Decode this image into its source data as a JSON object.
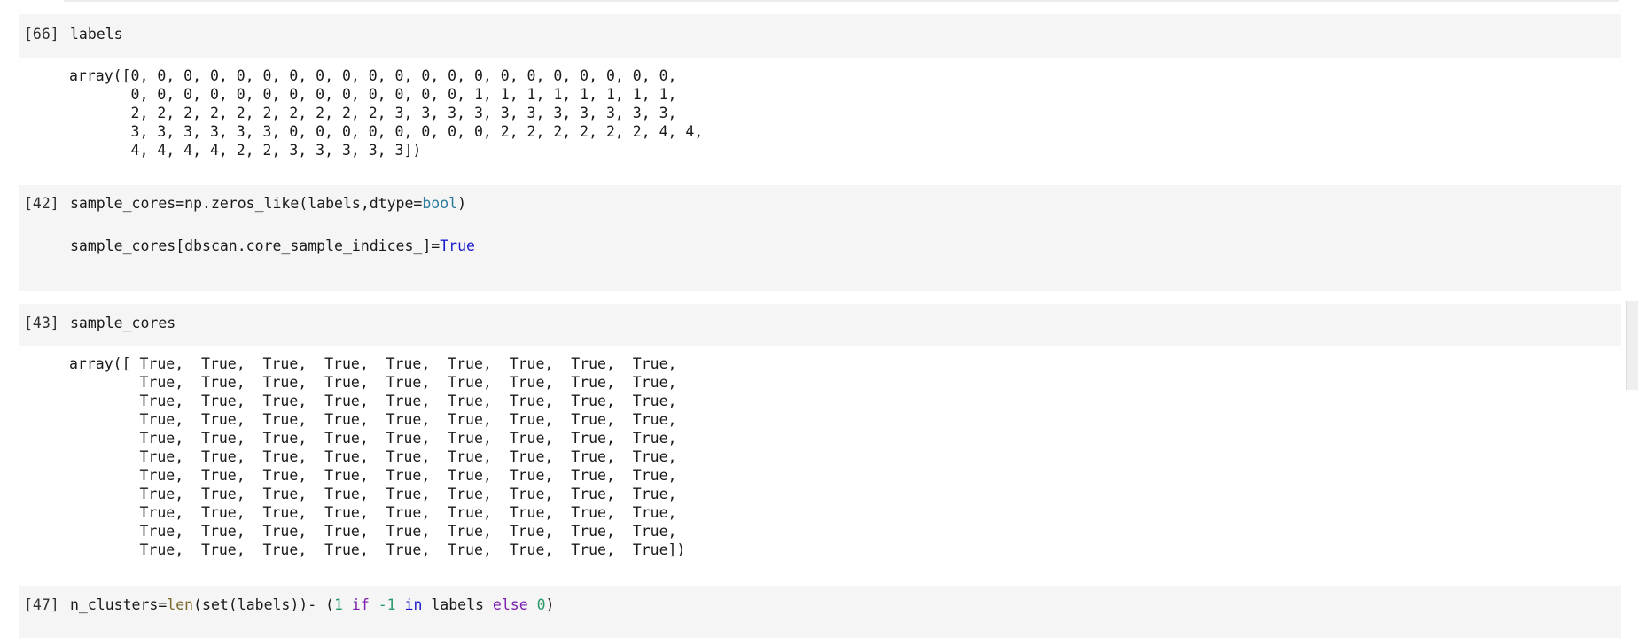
{
  "cells": [
    {
      "prompt": "[66]",
      "code": "labels",
      "output": [
        "array([0, 0, 0, 0, 0, 0, 0, 0, 0, 0, 0, 0, 0, 0, 0, 0, 0, 0, 0, 0, 0,",
        "       0, 0, 0, 0, 0, 0, 0, 0, 0, 0, 0, 0, 0, 1, 1, 1, 1, 1, 1, 1, 1,",
        "       2, 2, 2, 2, 2, 2, 2, 2, 2, 2, 3, 3, 3, 3, 3, 3, 3, 3, 3, 3, 3,",
        "       3, 3, 3, 3, 3, 3, 0, 0, 0, 0, 0, 0, 0, 0, 2, 2, 2, 2, 2, 2, 4, 4,",
        "       4, 4, 4, 4, 2, 2, 3, 3, 3, 3, 3])"
      ]
    },
    {
      "prompt": "[42]",
      "code_line1": {
        "pre": "sample_cores=np.zeros_like(labels,dtype=",
        "type": "bool",
        "post": ")"
      },
      "code_line2": {
        "pre": "sample_cores[dbscan.core_sample_indices_]=",
        "const": "True"
      }
    },
    {
      "prompt": "[43]",
      "code": "sample_cores",
      "output": [
        "array([ True,  True,  True,  True,  True,  True,  True,  True,  True,",
        "        True,  True,  True,  True,  True,  True,  True,  True,  True,",
        "        True,  True,  True,  True,  True,  True,  True,  True,  True,",
        "        True,  True,  True,  True,  True,  True,  True,  True,  True,",
        "        True,  True,  True,  True,  True,  True,  True,  True,  True,",
        "        True,  True,  True,  True,  True,  True,  True,  True,  True,",
        "        True,  True,  True,  True,  True,  True,  True,  True,  True,",
        "        True,  True,  True,  True,  True,  True,  True,  True,  True,",
        "        True,  True,  True,  True,  True,  True,  True,  True,  True,",
        "        True,  True,  True,  True,  True,  True,  True,  True,  True,",
        "        True,  True,  True,  True,  True,  True,  True,  True,  True])"
      ]
    },
    {
      "prompt": "[47]",
      "code_parts": {
        "p1": "n_clusters=",
        "len": "len",
        "p2": "(set(labels))- (",
        "one": "1",
        "if": " if ",
        "neg": "-1",
        "in": " in ",
        "p3": "labels ",
        "else": "else",
        "sp": " ",
        "zero": "0",
        "p4": ")"
      }
    }
  ]
}
